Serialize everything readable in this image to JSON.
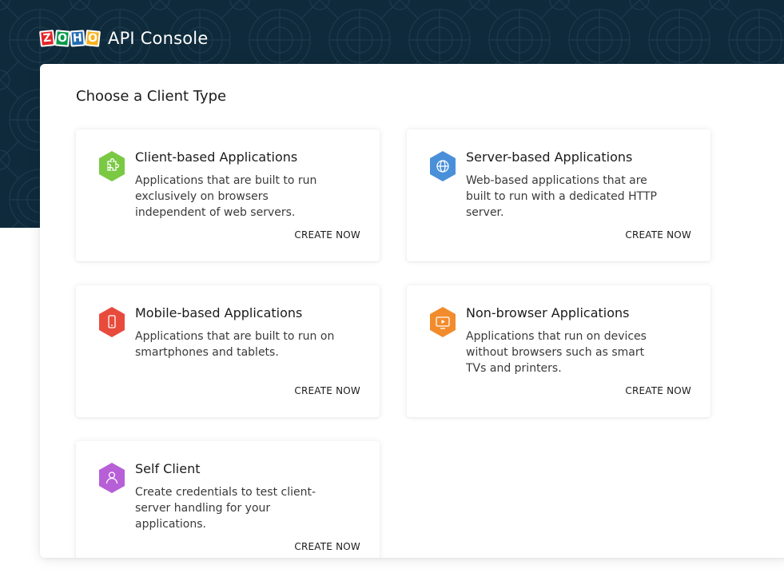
{
  "header": {
    "logo_letters": [
      "Z",
      "O",
      "H",
      "O"
    ],
    "logo_colors": [
      "#e42527",
      "#089949",
      "#226db4",
      "#f9b21d"
    ],
    "title": "API Console"
  },
  "main": {
    "title": "Choose a Client Type",
    "cards": [
      {
        "title": "Client-based Applications",
        "description": "Applications that are built to run exclusively on browsers independent of web servers.",
        "action": "CREATE NOW",
        "icon": "puzzle-icon",
        "color": "#7ac943"
      },
      {
        "title": "Server-based Applications",
        "description": "Web-based applications that are built to run with a dedicated HTTP server.",
        "action": "CREATE NOW",
        "icon": "globe-icon",
        "color": "#4a90d9"
      },
      {
        "title": "Mobile-based Applications",
        "description": "Applications that are built to run on smartphones and tablets.",
        "action": "CREATE NOW",
        "icon": "mobile-icon",
        "color": "#e84b3c"
      },
      {
        "title": "Non-browser Applications",
        "description": "Applications that run on devices without browsers such as smart TVs and printers.",
        "action": "CREATE NOW",
        "icon": "tv-icon",
        "color": "#f28b2b"
      },
      {
        "title": "Self Client",
        "description": "Create credentials to test client-server handling for your applications.",
        "action": "CREATE NOW",
        "icon": "user-icon",
        "color": "#b75fd6"
      }
    ]
  }
}
